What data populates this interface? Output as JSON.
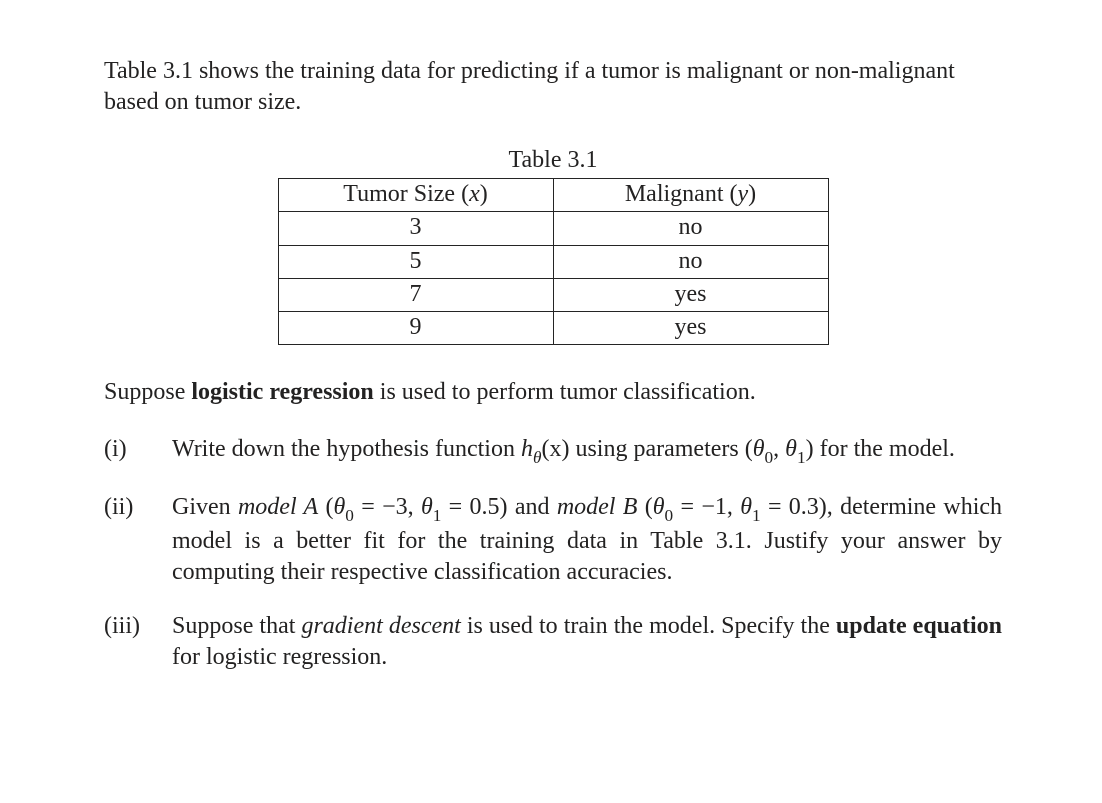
{
  "intro_before": "Table 3.1 shows the training data for predicting if a tumor is malignant or non-malignant based on tumor size.",
  "table": {
    "caption": "Table 3.1",
    "headers": {
      "col1_label": "Tumor Size (",
      "col1_var": "x",
      "col1_close": ")",
      "col2_label": "Malignant (",
      "col2_var": "y",
      "col2_close": ")"
    },
    "rows": [
      {
        "x": "3",
        "y": "no"
      },
      {
        "x": "5",
        "y": "no"
      },
      {
        "x": "7",
        "y": "yes"
      },
      {
        "x": "9",
        "y": "yes"
      }
    ]
  },
  "lead_before": "Suppose ",
  "lead_bold": "logistic regression",
  "lead_after": " is used to perform tumor classification.",
  "q1": {
    "label": "(i)",
    "t1": "Write down the hypothesis function ",
    "hvar": "h",
    "theta": "θ",
    "paren_x": "(x)",
    "t2": " using parameters (",
    "t3": ", ",
    "t4": ") for the model.",
    "th0": "θ",
    "th0_sub": "0",
    "th1": "θ",
    "th1_sub": "1"
  },
  "q2": {
    "label": "(ii)",
    "g1": "Given ",
    "modelA": "model A",
    "lpa": " (",
    "a_th0": "θ",
    "a_th0_sub": "0",
    "a_eq0": " = −3, ",
    "a_th1": "θ",
    "a_th1_sub": "1",
    "a_eq1": " = 0.5)",
    "g2": " and ",
    "modelB": "model B",
    "lpb": " (",
    "b_th0": "θ",
    "b_th0_sub": "0",
    "b_eq0": " = −1, ",
    "b_th1": "θ",
    "b_th1_sub": "1",
    "b_eq1": " = 0.3),",
    "rest": " determine which model is a better fit for the training data in Table 3.1. Justify your answer by computing their respective classification accuracies."
  },
  "q3": {
    "label": "(iii)",
    "t1": "Suppose that ",
    "gd": "gradient descent",
    "t2": " is used to train the model. Specify the ",
    "bold": "update equation",
    "t3": " for logistic regression."
  }
}
